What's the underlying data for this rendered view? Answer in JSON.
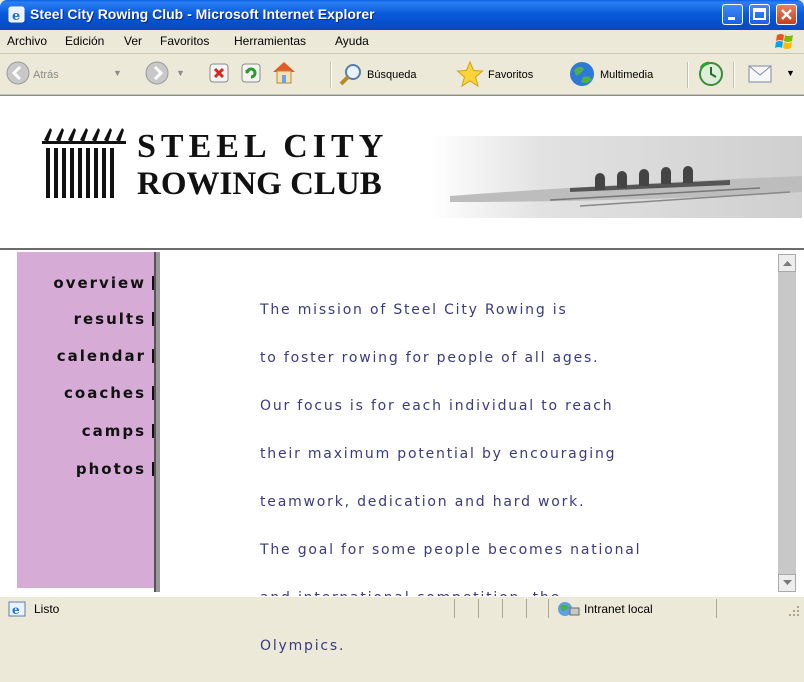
{
  "window": {
    "title": "Steel City Rowing Club - Microsoft Internet Explorer"
  },
  "menu": {
    "items": [
      "Archivo",
      "Edición",
      "Ver",
      "Favoritos",
      "Herramientas",
      "Ayuda"
    ]
  },
  "toolbar": {
    "back_label": "Atrás",
    "search_label": "Búsqueda",
    "favorites_label": "Favoritos",
    "media_label": "Multimedia"
  },
  "banner": {
    "line1": "STEEL CITY",
    "line2": "ROWING CLUB"
  },
  "nav": {
    "items": [
      "overview",
      "results",
      "calendar",
      "coaches",
      "camps",
      "photos"
    ]
  },
  "main": {
    "mission_lines": [
      "The mission of Steel City Rowing is",
      "to foster rowing for people of all ages.",
      "Our focus is for each individual to reach",
      "their maximum potential by encouraging",
      "teamwork, dedication and hard work.",
      "The goal for some people becomes national",
      "and international competition, the",
      "Olympics."
    ]
  },
  "status": {
    "text": "Listo",
    "zone": "Intranet local"
  },
  "colors": {
    "sidebar_bg": "#D6ABD6",
    "mission_text": "#3A3A80",
    "title_bar": "#0A5BD6"
  }
}
